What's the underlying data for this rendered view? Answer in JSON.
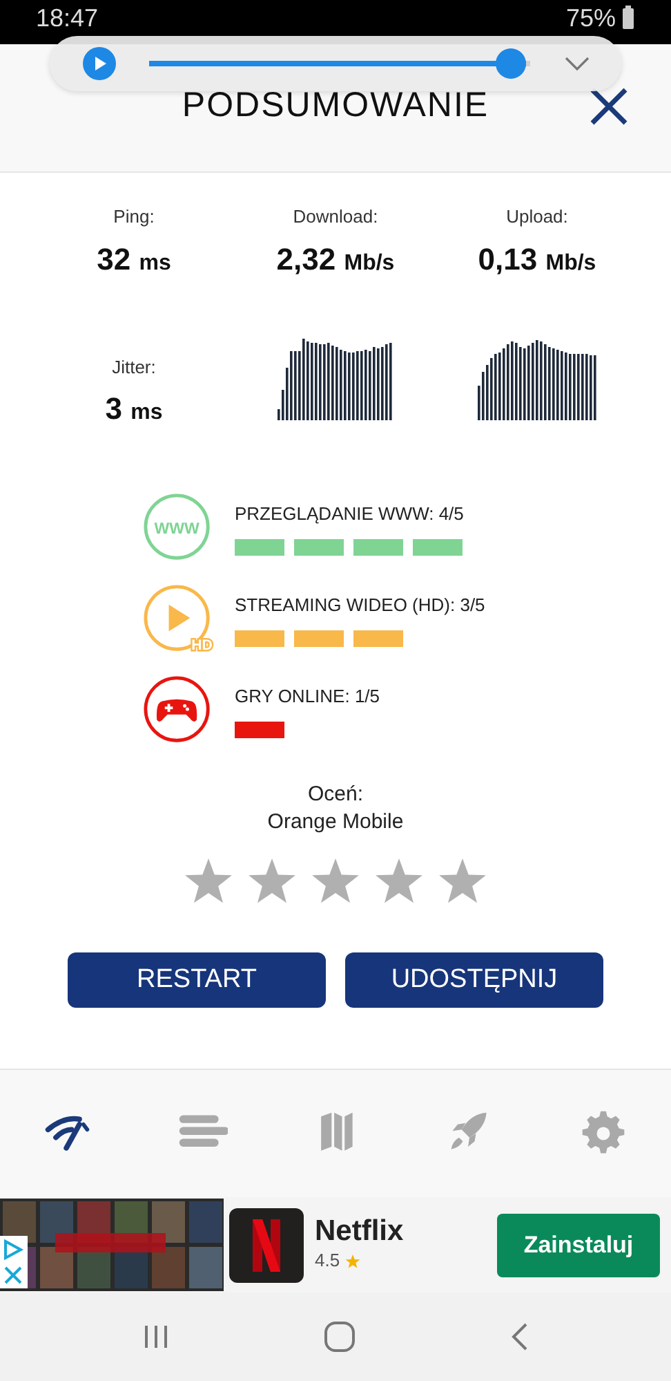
{
  "status_bar": {
    "time": "18:47",
    "battery": "75%"
  },
  "media_player": {
    "level": 0.99
  },
  "header": {
    "title": "PODSUMOWANIE"
  },
  "stats": [
    {
      "label": "Ping:",
      "value": "32",
      "unit": "ms"
    },
    {
      "label": "Download:",
      "value": "2,32",
      "unit": "Mb/s"
    },
    {
      "label": "Upload:",
      "value": "0,13",
      "unit": "Mb/s"
    },
    {
      "label": "Jitter:",
      "value": "3",
      "unit": "ms"
    }
  ],
  "ratings": [
    {
      "kind": "web",
      "label": "PRZEGLĄDANIE WWW: 4/5",
      "icon_text": "WWW",
      "color": "#7fd494",
      "segments": [
        {
          "filled": true
        },
        {
          "filled": true
        },
        {
          "filled": true
        },
        {
          "filled": true
        },
        {
          "filled": false
        }
      ]
    },
    {
      "kind": "video",
      "label": "STREAMING WIDEO (HD): 3/5",
      "icon_text": "HD",
      "color": "#f9b84a",
      "segments": [
        {
          "filled": true
        },
        {
          "filled": true
        },
        {
          "filled": true
        },
        {
          "filled": false
        },
        {
          "filled": false
        }
      ]
    },
    {
      "kind": "game",
      "label": "GRY ONLINE: 1/5",
      "color": "#e8150f",
      "segments": [
        {
          "filled": true
        },
        {
          "filled": false
        },
        {
          "filled": false
        },
        {
          "filled": false
        },
        {
          "filled": false
        }
      ]
    }
  ],
  "rate": {
    "prompt": "Oceń:",
    "operator": "Orange Mobile",
    "stars": 0
  },
  "buttons": [
    "RESTART",
    "UDOSTĘPNIJ"
  ],
  "bottom_nav": [
    {
      "kind": "speed",
      "selected": true
    },
    {
      "kind": "list",
      "selected": false
    },
    {
      "kind": "map",
      "selected": false
    },
    {
      "kind": "rocket",
      "selected": false
    },
    {
      "kind": "settings",
      "selected": false
    }
  ],
  "ad": {
    "app_name": "Netflix",
    "rating": "4.5",
    "button": "Zainstaluj"
  }
}
